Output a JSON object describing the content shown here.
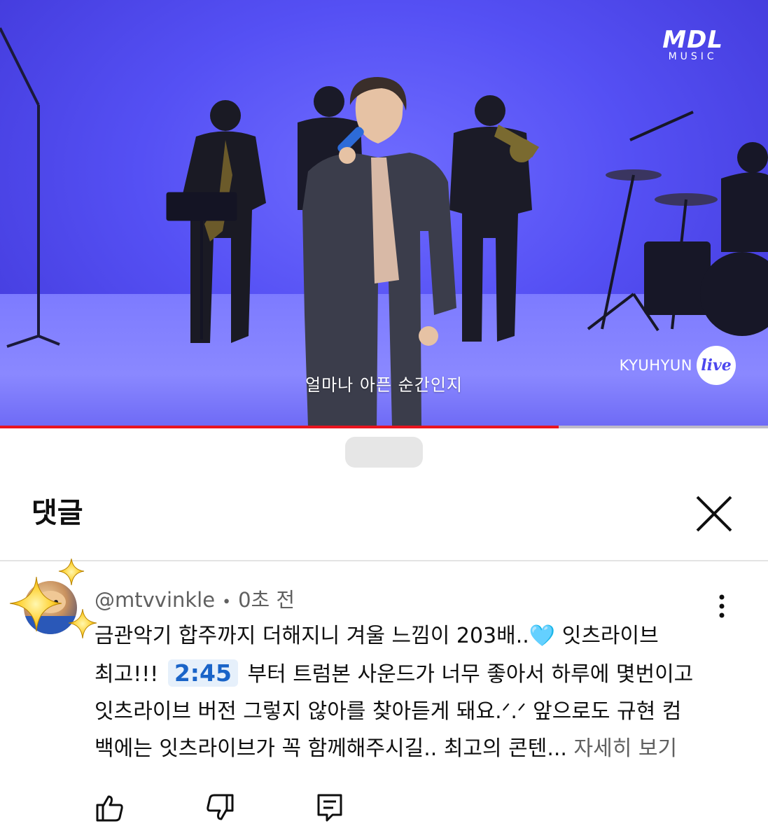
{
  "video": {
    "logo_main": "MDL",
    "logo_sub": "MUSIC",
    "subtitle": "얼마나 아픈 순간인지",
    "brand_name": "KYUHYUN",
    "brand_badge": "live",
    "progress_fraction": 0.727
  },
  "sheet": {
    "title": "댓글"
  },
  "comment": {
    "author": "@mtvvinkle",
    "separator": "•",
    "time_ago": "0초 전",
    "line1": "금관악기 합주까지 더해지니 겨울 느낌이 203배..",
    "line1_emoji": "🩵",
    "line1_tail": " 잇츠라이브",
    "line2_pre": "최고!!!",
    "timestamp": "2:45",
    "line2_post": "부터 트럼본 사운드가 너무 좋아서 하루에 몇번이고",
    "line3": "잇츠라이브 버전 그렇지 않아를 찾아듣게 돼요.ᐟ.ᐟ 앞으로도 규현 컴",
    "line4": "백에는 잇츠라이브가 꼭 함께해주시길.. 최고의 콘텐...",
    "read_more": "자세히 보기"
  },
  "colors": {
    "stage_blue": "#5550f4",
    "progress_red": "#e8141f",
    "timestamp_blue": "#1a64c8"
  },
  "icons": [
    "close-icon",
    "more-vert-icon",
    "like-icon",
    "dislike-icon",
    "reply-icon",
    "sparkle-icon"
  ]
}
